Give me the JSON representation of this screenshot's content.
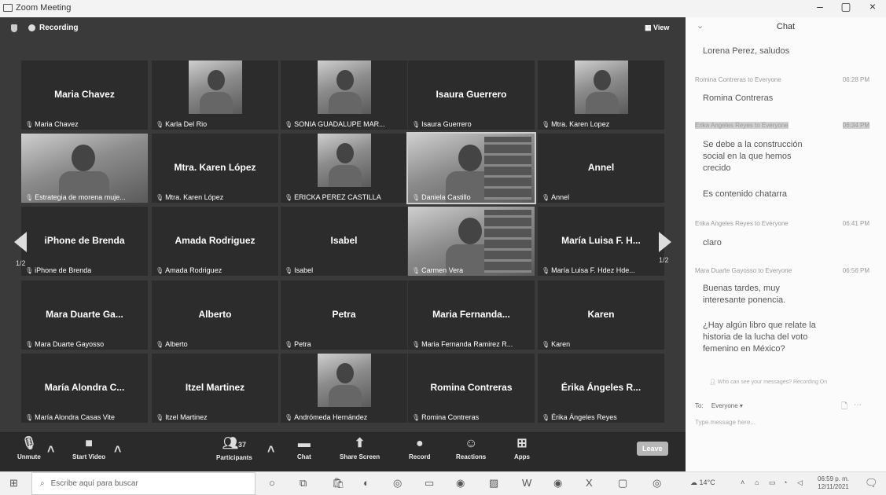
{
  "window": {
    "title": "Zoom Meeting",
    "min": "–",
    "max": "▢",
    "close": "×"
  },
  "topbar": {
    "recording": "Recording",
    "view": "View"
  },
  "pagination": {
    "left": "1/2",
    "right": "1/2"
  },
  "tiles": [
    {
      "name": "Maria Chavez",
      "label": "Maria Chavez",
      "video": false
    },
    {
      "name": "",
      "label": "Karla Del Rio",
      "video": true
    },
    {
      "name": "",
      "label": "SONIA GUADALUPE MAR...",
      "video": true
    },
    {
      "name": "Isaura Guerrero",
      "label": "Isaura Guerrero",
      "video": false
    },
    {
      "name": "",
      "label": "Mtra. Karen Lopez",
      "video": true
    },
    {
      "name": "",
      "label": "Estrategia de morena muje...",
      "video": true
    },
    {
      "name": "Mtra. Karen López",
      "label": "Mtra. Karen López",
      "video": false
    },
    {
      "name": "",
      "label": "ERICKA PEREZ CASTILLA",
      "video": true
    },
    {
      "name": "",
      "label": "Daniela Castillo",
      "video": true
    },
    {
      "name": "Annel",
      "label": "Annel",
      "video": false
    },
    {
      "name": "iPhone de Brenda",
      "label": "iPhone de Brenda",
      "video": false
    },
    {
      "name": "Amada Rodriguez",
      "label": "Amada Rodriguez",
      "video": false
    },
    {
      "name": "Isabel",
      "label": "Isabel",
      "video": false
    },
    {
      "name": "",
      "label": "Carmen Vera",
      "video": true
    },
    {
      "name": "María Luisa F. H...",
      "label": "María Luisa F. Hdez Hde...",
      "video": false
    },
    {
      "name": "Mara Duarte Ga...",
      "label": "Mara Duarte Gayosso",
      "video": false
    },
    {
      "name": "Alberto",
      "label": "Alberto",
      "video": false
    },
    {
      "name": "Petra",
      "label": "Petra",
      "video": false
    },
    {
      "name": "Maria Fernanda...",
      "label": "Maria Fernanda Ramirez R...",
      "video": false
    },
    {
      "name": "Karen",
      "label": "Karen",
      "video": false
    },
    {
      "name": "María Alondra C...",
      "label": "María Alondra Casas Vite",
      "video": false
    },
    {
      "name": "Itzel Martinez",
      "label": "Itzel Martinez",
      "video": false
    },
    {
      "name": "",
      "label": "Andrómeda Hernández",
      "video": true
    },
    {
      "name": "Romina Contreras",
      "label": "Romina Contreras",
      "video": false
    },
    {
      "name": "Érika Ángeles R...",
      "label": "Érika Ángeles Reyes",
      "video": false
    }
  ],
  "toolbar": {
    "unmute": "Unmute",
    "start_video": "Start Video",
    "participants": "Participants",
    "participants_count": "37",
    "chat": "Chat",
    "share": "Share Screen",
    "record": "Record",
    "reactions": "Reactions",
    "apps": "Apps",
    "leave": "Leave"
  },
  "chat": {
    "header": "Chat",
    "m1": "Lorena Perez, saludos",
    "meta2_from": "Romina Contreras to Everyone",
    "meta2_time": "06:28 PM",
    "m2": "Romina Contreras",
    "meta3_from": "Erika Angeles Reyes to Everyone",
    "meta3_time": "06:34 PM",
    "m3": "Se debe a la construcción social en la que hemos crecido",
    "m4": "Es contenido chatarra",
    "meta5_from": "Erika Angeles Reyes to Everyone",
    "meta5_time": "06:41 PM",
    "m5": "claro",
    "meta6_from": "Mara Duarte Gayosso to Everyone",
    "meta6_time": "06:56 PM",
    "m6": "Buenas tardes, muy interesante ponencia.",
    "m7": "¿Hay algún libro que relate la historia de la lucha del voto femenino en México?",
    "note": "Who can see your messages? Recording On",
    "to_label": "To:",
    "to_value": "Everyone ▾",
    "placeholder": "Type message here..."
  },
  "taskbar": {
    "search_placeholder": "Escribe aquí para buscar",
    "temp": "14°C",
    "time": "06:59 p. m.",
    "date": "12/11/2021"
  }
}
